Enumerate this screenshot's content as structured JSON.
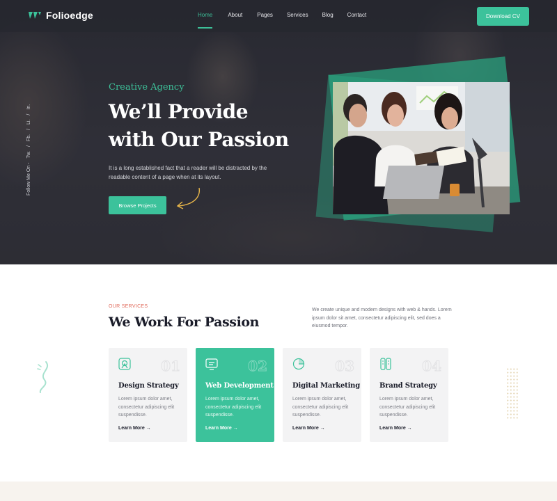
{
  "brand": {
    "name": "Folioedge",
    "accent": "#3cc29b"
  },
  "nav": {
    "items": [
      {
        "label": "Home",
        "active": true
      },
      {
        "label": "About",
        "active": false
      },
      {
        "label": "Pages",
        "active": false
      },
      {
        "label": "Services",
        "active": false
      },
      {
        "label": "Blog",
        "active": false
      },
      {
        "label": "Contact",
        "active": false
      }
    ],
    "cta_label": "Download CV"
  },
  "social": {
    "follow_label": "Follow Me On -",
    "items": [
      "Tw.",
      "/",
      "Fb.",
      "/",
      "Li.",
      "/",
      "In."
    ]
  },
  "hero": {
    "eyebrow": "Creative Agency",
    "title_line1": "We’ll Provide",
    "title_line2": "with Our Passion",
    "text": "It is a long established fact that a reader will be distracted by the readable content of a page when at its layout.",
    "button_label": "Browse Projects"
  },
  "services": {
    "eyebrow": "OUR SERVICES",
    "title": "We Work For Passion",
    "description": "We create unique and modern designs with web & hands. Lorem ipsum dolor sit amet, consectetur adipiscing elit, sed does a eiusmod tempor.",
    "cards": [
      {
        "icon": "design-icon",
        "number": "01",
        "title": "Design Strategy",
        "text": "Lorem ipsum dolor amet, consectetur adipiscing elit suspendisse.",
        "link": "Learn More →",
        "active": false
      },
      {
        "icon": "web-icon",
        "number": "02",
        "title": "Web Development",
        "text": "Lorem ipsum dolor amet, consectetur adipiscing elit suspendisse.",
        "link": "Learn More →",
        "active": true
      },
      {
        "icon": "chart-icon",
        "number": "03",
        "title": "Digital Marketing",
        "text": "Lorem ipsum dolor amet, consectetur adipiscing elit suspendisse.",
        "link": "Learn More →",
        "active": false
      },
      {
        "icon": "brand-icon",
        "number": "04",
        "title": "Brand Strategy",
        "text": "Lorem ipsum dolor amet, consectetur adipiscing elit suspendisse.",
        "link": "Learn More →",
        "active": false
      }
    ]
  }
}
